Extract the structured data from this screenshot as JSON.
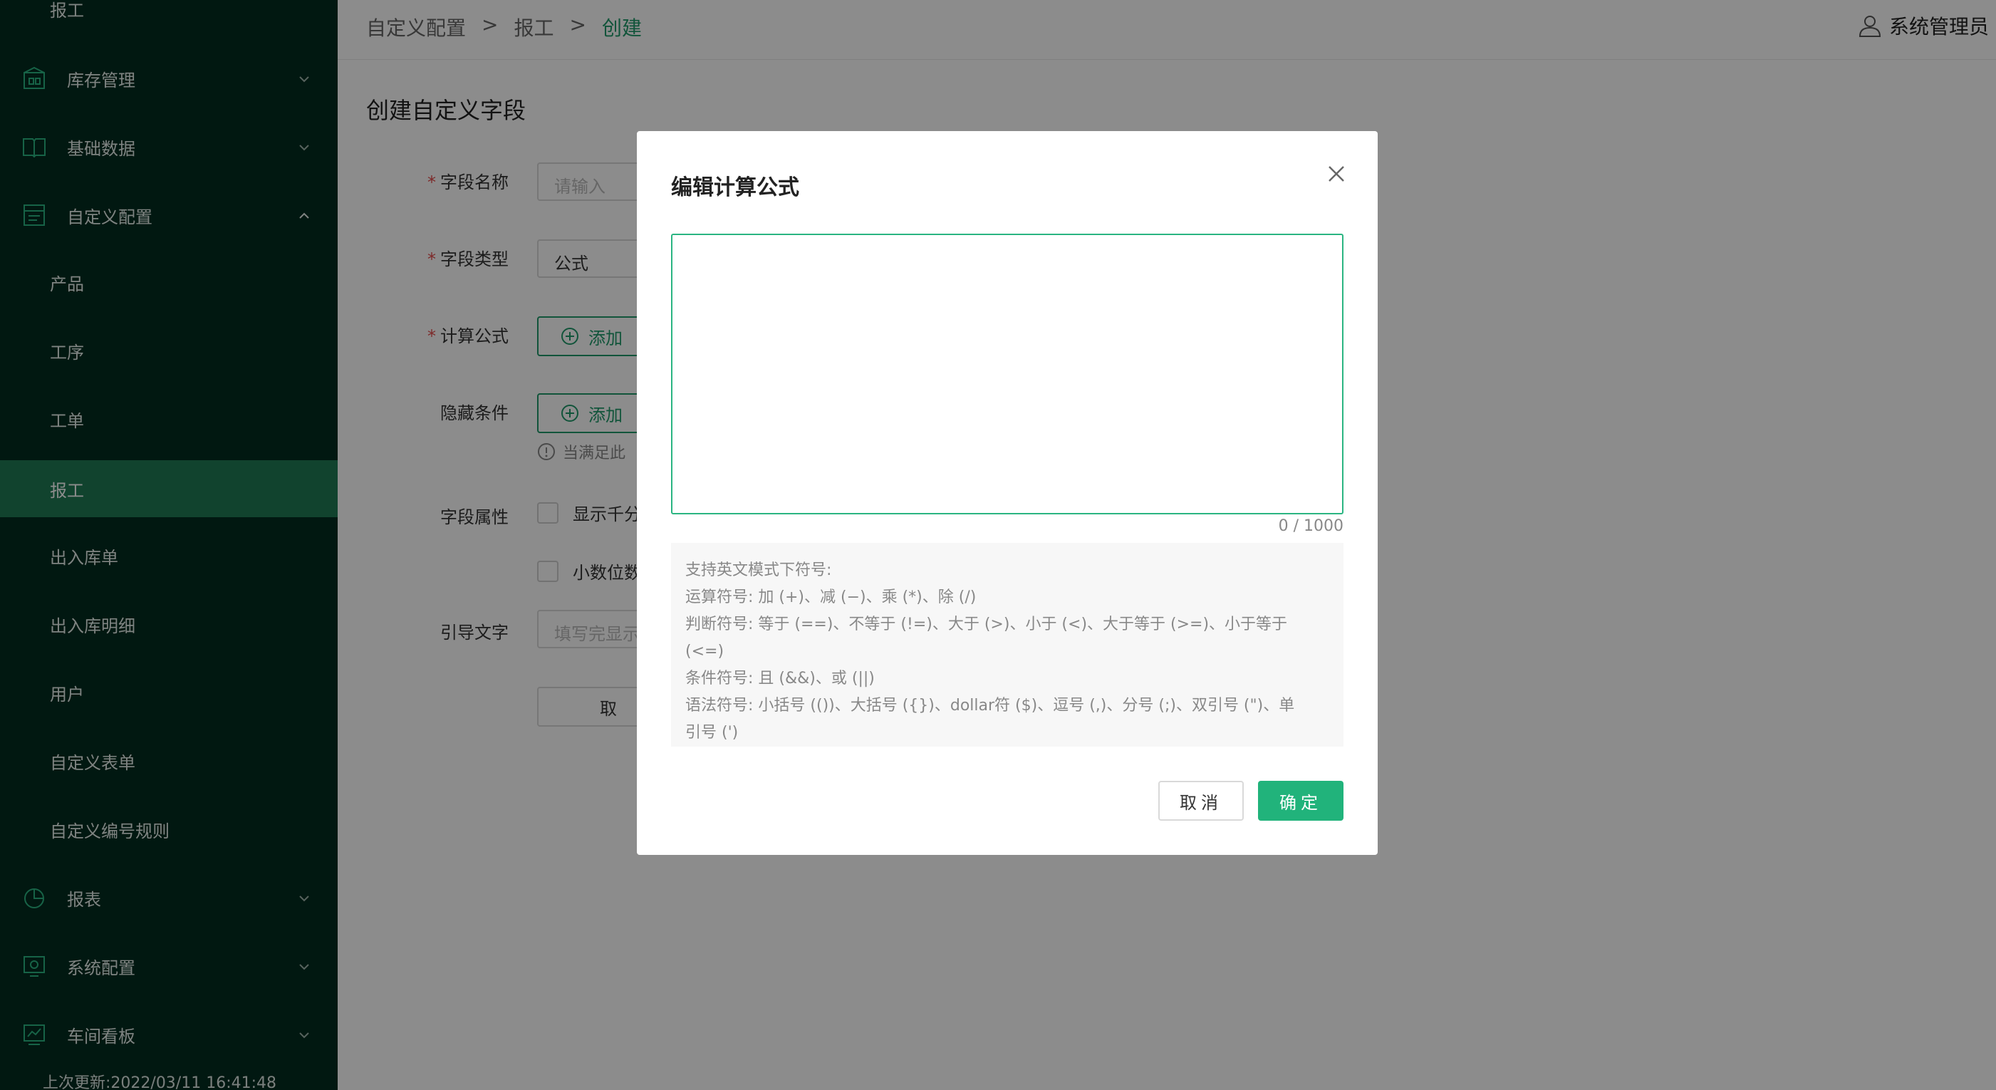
{
  "sidebar": {
    "top_partial": "报工",
    "groups": [
      {
        "label": "库存管理"
      },
      {
        "label": "基础数据"
      },
      {
        "label": "自定义配置"
      }
    ],
    "sub_items": [
      {
        "label": "产品"
      },
      {
        "label": "工序"
      },
      {
        "label": "工单"
      },
      {
        "label": "报工"
      },
      {
        "label": "出入库单"
      },
      {
        "label": "出入库明细"
      },
      {
        "label": "用户"
      },
      {
        "label": "自定义表单"
      },
      {
        "label": "自定义编号规则"
      }
    ],
    "bottom_groups": [
      {
        "label": "报表"
      },
      {
        "label": "系统配置"
      },
      {
        "label": "车间看板"
      }
    ],
    "last_update": "上次更新:2022/03/11 16:41:48"
  },
  "header": {
    "breadcrumb": [
      "自定义配置",
      ">",
      "报工",
      ">",
      "创建"
    ],
    "user": "系统管理员"
  },
  "form": {
    "title": "创建自定义字段",
    "field_name_label": "字段名称",
    "field_name_placeholder": "请输入",
    "field_type_label": "字段类型",
    "field_type_value": "公式",
    "formula_label": "计算公式",
    "add_label": "添加",
    "hidden_label": "隐藏条件",
    "hidden_hint": "当满足此",
    "attr_label": "字段属性",
    "attr_opt1": "显示千分",
    "attr_opt2": "小数位数",
    "guide_label": "引导文字",
    "guide_placeholder": "填写完显示",
    "cancel_partial": "取"
  },
  "modal": {
    "title": "编辑计算公式",
    "counter": "0 / 1000",
    "help_lines": [
      "支持英文模式下符号:",
      "运算符号: 加 (+)、减 (−)、乘 (*)、除 (/)",
      "判断符号: 等于 (==)、不等于 (!=)、大于 (>)、小于 (<)、大于等于 (>=)、小于等于",
      "(<=)",
      "条件符号: 且 (&&)、或 (||)",
      "语法符号: 小括号 (())、大括号 ({})、dollar符 ($)、逗号 (,)、分号 (;)、双引号 (\")、单",
      "引号 (')"
    ],
    "cancel": "取消",
    "ok": "确定"
  }
}
